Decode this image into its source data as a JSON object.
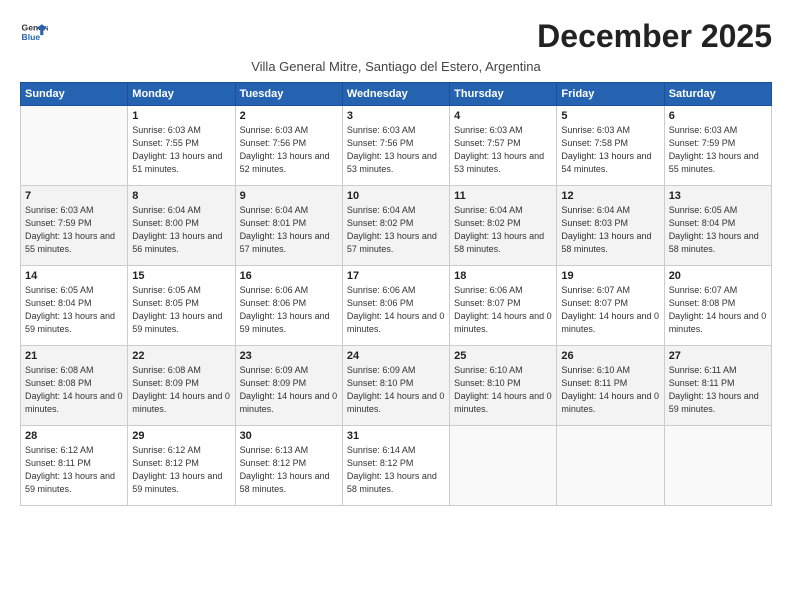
{
  "logo": {
    "general": "General",
    "blue": "Blue"
  },
  "title": "December 2025",
  "subtitle": "Villa General Mitre, Santiago del Estero, Argentina",
  "weekdays": [
    "Sunday",
    "Monday",
    "Tuesday",
    "Wednesday",
    "Thursday",
    "Friday",
    "Saturday"
  ],
  "weeks": [
    [
      {
        "day": "",
        "sunrise": "",
        "sunset": "",
        "daylight": ""
      },
      {
        "day": "1",
        "sunrise": "Sunrise: 6:03 AM",
        "sunset": "Sunset: 7:55 PM",
        "daylight": "Daylight: 13 hours and 51 minutes."
      },
      {
        "day": "2",
        "sunrise": "Sunrise: 6:03 AM",
        "sunset": "Sunset: 7:56 PM",
        "daylight": "Daylight: 13 hours and 52 minutes."
      },
      {
        "day": "3",
        "sunrise": "Sunrise: 6:03 AM",
        "sunset": "Sunset: 7:56 PM",
        "daylight": "Daylight: 13 hours and 53 minutes."
      },
      {
        "day": "4",
        "sunrise": "Sunrise: 6:03 AM",
        "sunset": "Sunset: 7:57 PM",
        "daylight": "Daylight: 13 hours and 53 minutes."
      },
      {
        "day": "5",
        "sunrise": "Sunrise: 6:03 AM",
        "sunset": "Sunset: 7:58 PM",
        "daylight": "Daylight: 13 hours and 54 minutes."
      },
      {
        "day": "6",
        "sunrise": "Sunrise: 6:03 AM",
        "sunset": "Sunset: 7:59 PM",
        "daylight": "Daylight: 13 hours and 55 minutes."
      }
    ],
    [
      {
        "day": "7",
        "sunrise": "Sunrise: 6:03 AM",
        "sunset": "Sunset: 7:59 PM",
        "daylight": "Daylight: 13 hours and 55 minutes."
      },
      {
        "day": "8",
        "sunrise": "Sunrise: 6:04 AM",
        "sunset": "Sunset: 8:00 PM",
        "daylight": "Daylight: 13 hours and 56 minutes."
      },
      {
        "day": "9",
        "sunrise": "Sunrise: 6:04 AM",
        "sunset": "Sunset: 8:01 PM",
        "daylight": "Daylight: 13 hours and 57 minutes."
      },
      {
        "day": "10",
        "sunrise": "Sunrise: 6:04 AM",
        "sunset": "Sunset: 8:02 PM",
        "daylight": "Daylight: 13 hours and 57 minutes."
      },
      {
        "day": "11",
        "sunrise": "Sunrise: 6:04 AM",
        "sunset": "Sunset: 8:02 PM",
        "daylight": "Daylight: 13 hours and 58 minutes."
      },
      {
        "day": "12",
        "sunrise": "Sunrise: 6:04 AM",
        "sunset": "Sunset: 8:03 PM",
        "daylight": "Daylight: 13 hours and 58 minutes."
      },
      {
        "day": "13",
        "sunrise": "Sunrise: 6:05 AM",
        "sunset": "Sunset: 8:04 PM",
        "daylight": "Daylight: 13 hours and 58 minutes."
      }
    ],
    [
      {
        "day": "14",
        "sunrise": "Sunrise: 6:05 AM",
        "sunset": "Sunset: 8:04 PM",
        "daylight": "Daylight: 13 hours and 59 minutes."
      },
      {
        "day": "15",
        "sunrise": "Sunrise: 6:05 AM",
        "sunset": "Sunset: 8:05 PM",
        "daylight": "Daylight: 13 hours and 59 minutes."
      },
      {
        "day": "16",
        "sunrise": "Sunrise: 6:06 AM",
        "sunset": "Sunset: 8:06 PM",
        "daylight": "Daylight: 13 hours and 59 minutes."
      },
      {
        "day": "17",
        "sunrise": "Sunrise: 6:06 AM",
        "sunset": "Sunset: 8:06 PM",
        "daylight": "Daylight: 14 hours and 0 minutes."
      },
      {
        "day": "18",
        "sunrise": "Sunrise: 6:06 AM",
        "sunset": "Sunset: 8:07 PM",
        "daylight": "Daylight: 14 hours and 0 minutes."
      },
      {
        "day": "19",
        "sunrise": "Sunrise: 6:07 AM",
        "sunset": "Sunset: 8:07 PM",
        "daylight": "Daylight: 14 hours and 0 minutes."
      },
      {
        "day": "20",
        "sunrise": "Sunrise: 6:07 AM",
        "sunset": "Sunset: 8:08 PM",
        "daylight": "Daylight: 14 hours and 0 minutes."
      }
    ],
    [
      {
        "day": "21",
        "sunrise": "Sunrise: 6:08 AM",
        "sunset": "Sunset: 8:08 PM",
        "daylight": "Daylight: 14 hours and 0 minutes."
      },
      {
        "day": "22",
        "sunrise": "Sunrise: 6:08 AM",
        "sunset": "Sunset: 8:09 PM",
        "daylight": "Daylight: 14 hours and 0 minutes."
      },
      {
        "day": "23",
        "sunrise": "Sunrise: 6:09 AM",
        "sunset": "Sunset: 8:09 PM",
        "daylight": "Daylight: 14 hours and 0 minutes."
      },
      {
        "day": "24",
        "sunrise": "Sunrise: 6:09 AM",
        "sunset": "Sunset: 8:10 PM",
        "daylight": "Daylight: 14 hours and 0 minutes."
      },
      {
        "day": "25",
        "sunrise": "Sunrise: 6:10 AM",
        "sunset": "Sunset: 8:10 PM",
        "daylight": "Daylight: 14 hours and 0 minutes."
      },
      {
        "day": "26",
        "sunrise": "Sunrise: 6:10 AM",
        "sunset": "Sunset: 8:11 PM",
        "daylight": "Daylight: 14 hours and 0 minutes."
      },
      {
        "day": "27",
        "sunrise": "Sunrise: 6:11 AM",
        "sunset": "Sunset: 8:11 PM",
        "daylight": "Daylight: 13 hours and 59 minutes."
      }
    ],
    [
      {
        "day": "28",
        "sunrise": "Sunrise: 6:12 AM",
        "sunset": "Sunset: 8:11 PM",
        "daylight": "Daylight: 13 hours and 59 minutes."
      },
      {
        "day": "29",
        "sunrise": "Sunrise: 6:12 AM",
        "sunset": "Sunset: 8:12 PM",
        "daylight": "Daylight: 13 hours and 59 minutes."
      },
      {
        "day": "30",
        "sunrise": "Sunrise: 6:13 AM",
        "sunset": "Sunset: 8:12 PM",
        "daylight": "Daylight: 13 hours and 58 minutes."
      },
      {
        "day": "31",
        "sunrise": "Sunrise: 6:14 AM",
        "sunset": "Sunset: 8:12 PM",
        "daylight": "Daylight: 13 hours and 58 minutes."
      },
      {
        "day": "",
        "sunrise": "",
        "sunset": "",
        "daylight": ""
      },
      {
        "day": "",
        "sunrise": "",
        "sunset": "",
        "daylight": ""
      },
      {
        "day": "",
        "sunrise": "",
        "sunset": "",
        "daylight": ""
      }
    ]
  ]
}
